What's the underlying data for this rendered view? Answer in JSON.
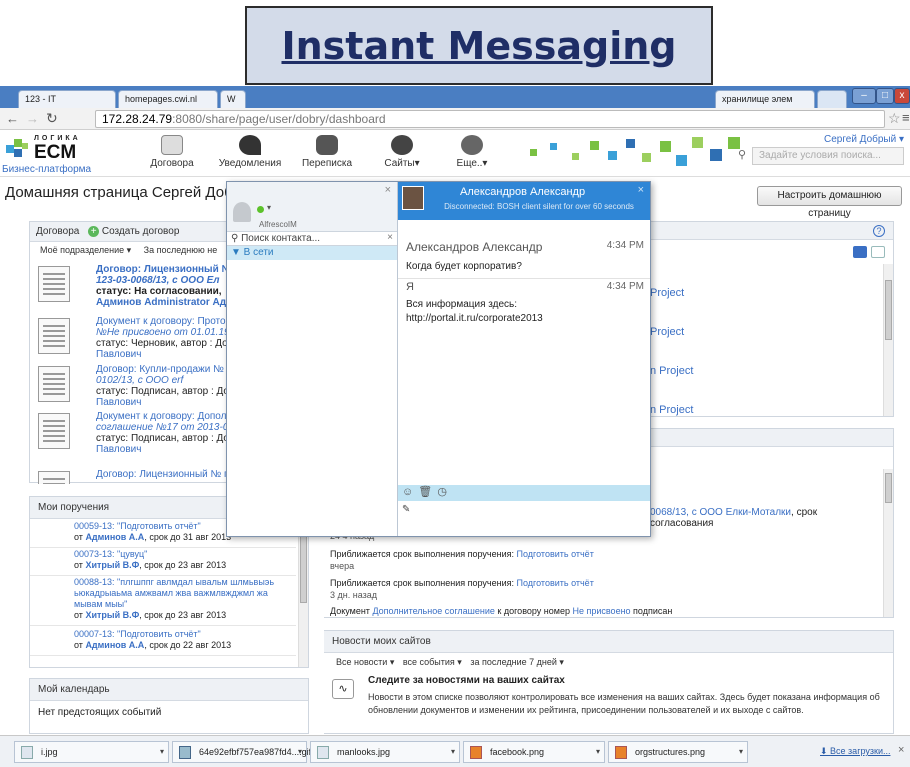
{
  "banner": {
    "title": "Instant Messaging"
  },
  "browser": {
    "tabs": [
      "123 - IT",
      "homepages.cwi.nl",
      "W",
      "хранилище элем",
      ""
    ],
    "tab_close": "×",
    "url_host": "172.28.24.79",
    "url_rest": ":8080/share/page/user/dobry/dashboard",
    "win_min": "–",
    "win_max": "□",
    "win_close": "x"
  },
  "app": {
    "logo_small": "ЛОГИКА",
    "logo_big": "ECM",
    "logo_sub": "Бизнес-платформа",
    "nav": [
      "Договора",
      "Уведомления",
      "Переписка",
      "Сайты▾",
      "Еще..▾"
    ],
    "user": "Сергей Добрый ▾",
    "search_placeholder": "Задайте условия поиска..."
  },
  "page": {
    "title": "Домашняя страница Сергей Добры",
    "customize": "Настроить домашнюю страницу"
  },
  "contracts": {
    "title": "Договора",
    "create": "Создать договор",
    "filter1": "Моё подразделение ▾",
    "filter2": "За последнюю не",
    "items": [
      {
        "l1": "Договор: Лицензионный №",
        "l2": "123-03-0068/13, с ООО Ел",
        "l3": "статус: На согласовании,",
        "l4": "Админов Administrator Адм"
      },
      {
        "l1": "Документ к договору: Протоко",
        "l2": "№Не присвоено от 01.01.1970",
        "l3": "статус: Черновик, автор : Доб",
        "l4": "Павлович"
      },
      {
        "l1": "Договор: Купли-продажи № пр",
        "l2": "0102/13, с ООО erf",
        "l3": "статус: Подписан, автор : Доб",
        "l4": "Павлович"
      },
      {
        "l1": "Документ к договору: Дополни",
        "l2": "соглашение №17 от 2013-08-23",
        "l3": "статус: Подписан, автор : Доб",
        "l4": "Павлович"
      },
      {
        "l1": "Договор: Лицензионный № пп",
        "l2": "",
        "l3": "",
        "l4": ""
      }
    ]
  },
  "projects": {
    "items": [
      "Project",
      "Project",
      "n Project",
      "n Project"
    ]
  },
  "tasks": {
    "title": "Мои поручения",
    "items": [
      {
        "l1": "00059-13: \"Подготовить отчёт\"",
        "l2a": "от ",
        "l2b": "Админов А.А",
        "l2c": ", срок до 31 авг 2013"
      },
      {
        "l1": "00073-13: \"цувуц\"",
        "l2a": "от ",
        "l2b": "Хитрый В.Ф",
        "l2c": ", срок до 23 авг 2013"
      },
      {
        "l1": "00088-13: \"плгшппг авлмдал ывальм шлмьвыэь ьюкадрыаьма амжвамл жва важмлвжджмл жа мывам мыы\"",
        "l2a": "от ",
        "l2b": "Хитрый В.Ф",
        "l2c": ", срок до 23 авг 2013"
      },
      {
        "l1": "00007-13: \"Подготовить отчёт\"",
        "l2a": "от ",
        "l2b": "Админов А.А",
        "l2c": ", срок до 22 авг 2013"
      }
    ]
  },
  "activity": {
    "first_link": "0068/13, с ООО Елки-Моталки",
    "first_tail": ", срок согласования",
    "first_time": "24 4 назад",
    "items": [
      {
        "text": "Приближается срок выполнения поручения: ",
        "link": "Подготовить отчёт",
        "time": "вчера"
      },
      {
        "text": "Приближается срок выполнения поручения: ",
        "link": "Подготовить отчёт",
        "time": "3 дн. назад"
      }
    ],
    "last_a": "Документ ",
    "last_link1": "Дополнительное соглашение",
    "last_b": " к договору номер ",
    "last_link2": "Не присвоено",
    "last_c": " подписан"
  },
  "calendar": {
    "title": "Мой календарь",
    "empty": "Нет предстоящих событий"
  },
  "sitenews": {
    "title": "Новости моих сайтов",
    "filters": [
      "Все новости ▾",
      "все события ▾",
      "за последние 7 дней ▾"
    ],
    "heading": "Следите за новостями на ваших сайтах",
    "body": "Новости в этом списке позволяют контролировать все изменения на ваших сайтах. Здесь будет показана информация об обновлении документов и изменении их рейтинга, присоединении пользователей и их выходе с сайтов."
  },
  "im": {
    "account": "AlfrescoIM",
    "search_placeholder": "Поиск контакта...",
    "group": "▼ В сети",
    "chat_title": "Александров Александр",
    "chat_status": "Disconnected: BOSH client silent for over 60 seconds",
    "messages": [
      {
        "from": "Александров Александр",
        "time": "4:34 PM",
        "text": "Когда будет корпоратив?"
      },
      {
        "from": "Я",
        "time": "4:34 PM",
        "text": "Вся информация здесь: http://portal.it.ru/corporate2013"
      }
    ],
    "close": "×"
  },
  "downloads": {
    "files": [
      "i.jpg",
      "64e92efbf757ea987fd4....gif",
      "manlooks.jpg",
      "facebook.png",
      "orgstructures.png"
    ],
    "all": "Все загрузки...",
    "close": "×"
  },
  "colors": {
    "link": "#3a6fc4",
    "im_header": "#2f86d6",
    "im_bar": "#bfe3f3",
    "tabbar": "#4a7ec2"
  }
}
